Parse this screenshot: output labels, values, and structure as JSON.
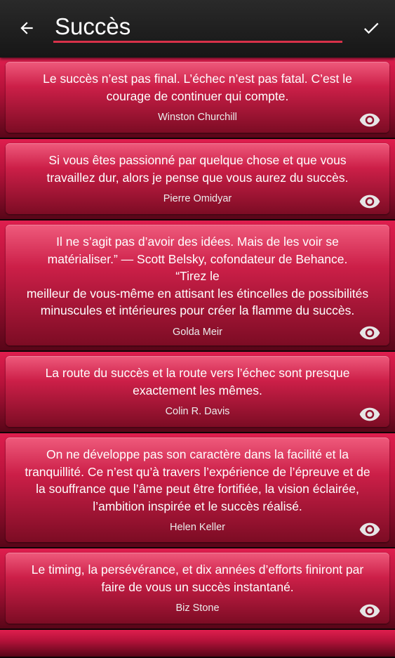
{
  "header": {
    "search_value": "Succès",
    "back_icon": "arrow-back-icon",
    "confirm_icon": "check-icon",
    "accent_color": "#d8324a"
  },
  "quotes": [
    {
      "text": "Le succès n’est pas final. L’échec n’est pas fatal. C’est le courage de continuer qui compte.",
      "author": "Winston Churchill"
    },
    {
      "text": "Si vous êtes passionné par quelque chose et que vous travaillez dur, alors je pense que vous aurez du succès.",
      "author": "Pierre Omidyar"
    },
    {
      "text": "Il ne s’agit pas d’avoir des idées. Mais de les voir se matérialiser.” — Scott Belsky, cofondateur de Behance.\n“Tirez le\nmeilleur de vous-même en attisant les étincelles de possibilités minuscules et intérieures pour créer la flamme du succès.",
      "author": "Golda Meir"
    },
    {
      "text": "La route du succès et la route vers l’échec sont presque exactement les mêmes.",
      "author": "Colin R. Davis"
    },
    {
      "text": "On ne développe pas son caractère dans la facilité et la tranquillité. Ce n’est qu’à travers l’expérience de l’épreuve et de la souffrance que l’âme peut être fortifiée, la vision éclairée, l’ambition inspirée et le succès réalisé.",
      "author": "Helen Keller"
    },
    {
      "text": "Le timing, la persévérance, et dix années d’efforts finiront par faire de vous un succès instantané.",
      "author": "Biz Stone"
    }
  ],
  "card_action_icon": "eye-icon"
}
